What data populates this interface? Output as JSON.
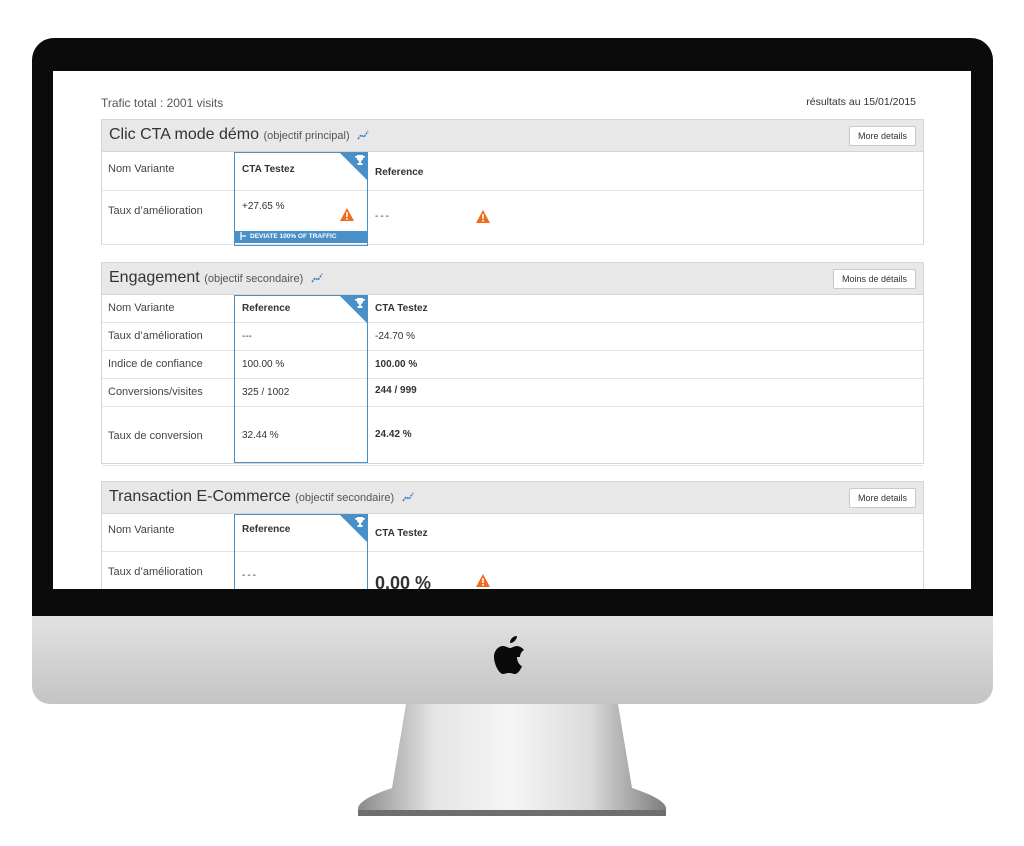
{
  "header": {
    "traffic_total": "Trafic total : 2001 visits",
    "results_date": "résultats au 15/01/2015"
  },
  "sections": [
    {
      "title": "Clic CTA mode démo",
      "subtitle": "(objectif principal)",
      "button": "More details",
      "col1_head": "CTA Testez",
      "col2_head": "Reference",
      "rows": [
        {
          "label": "Nom Variante"
        },
        {
          "label": "Taux d’amélioration",
          "col1": "+27.65 %",
          "col2": "---",
          "badge": "DEVIATE 100% OF TRAFFIC"
        }
      ]
    },
    {
      "title": "Engagement",
      "subtitle": "(objectif secondaire)",
      "button": "Moins de détails",
      "col1_head": "Reference",
      "col2_head": "CTA Testez",
      "rows": [
        {
          "label": "Nom Variante"
        },
        {
          "label": "Taux d’amélioration",
          "col1": "---",
          "col2": "-24.70 %"
        },
        {
          "label": "Indice de confiance",
          "col1": "100.00 %",
          "col2": "100.00 %"
        },
        {
          "label": "Conversions/visites",
          "col1": "325 / 1002",
          "col2": "244 / 999"
        },
        {
          "label": "Taux de conversion",
          "col1": "32.44 %",
          "col2": "24.42 %"
        }
      ]
    },
    {
      "title": "Transaction E-Commerce",
      "subtitle": "(objectif secondaire)",
      "button": "More details",
      "col1_head": "Reference",
      "col2_head": "CTA Testez",
      "rows": [
        {
          "label": "Nom Variante"
        },
        {
          "label": "Taux d’amélioration",
          "col1": "---",
          "col2": "0.00 %"
        }
      ]
    }
  ],
  "colors": {
    "accent": "#4a90c8",
    "warning": "#f26a1b",
    "header_bg": "#e8e8e8"
  },
  "icons": {
    "trend": "trend-line-icon",
    "trophy": "trophy-icon",
    "warning": "warning-triangle-icon",
    "apple": "apple-logo",
    "branch": "branch-icon"
  }
}
